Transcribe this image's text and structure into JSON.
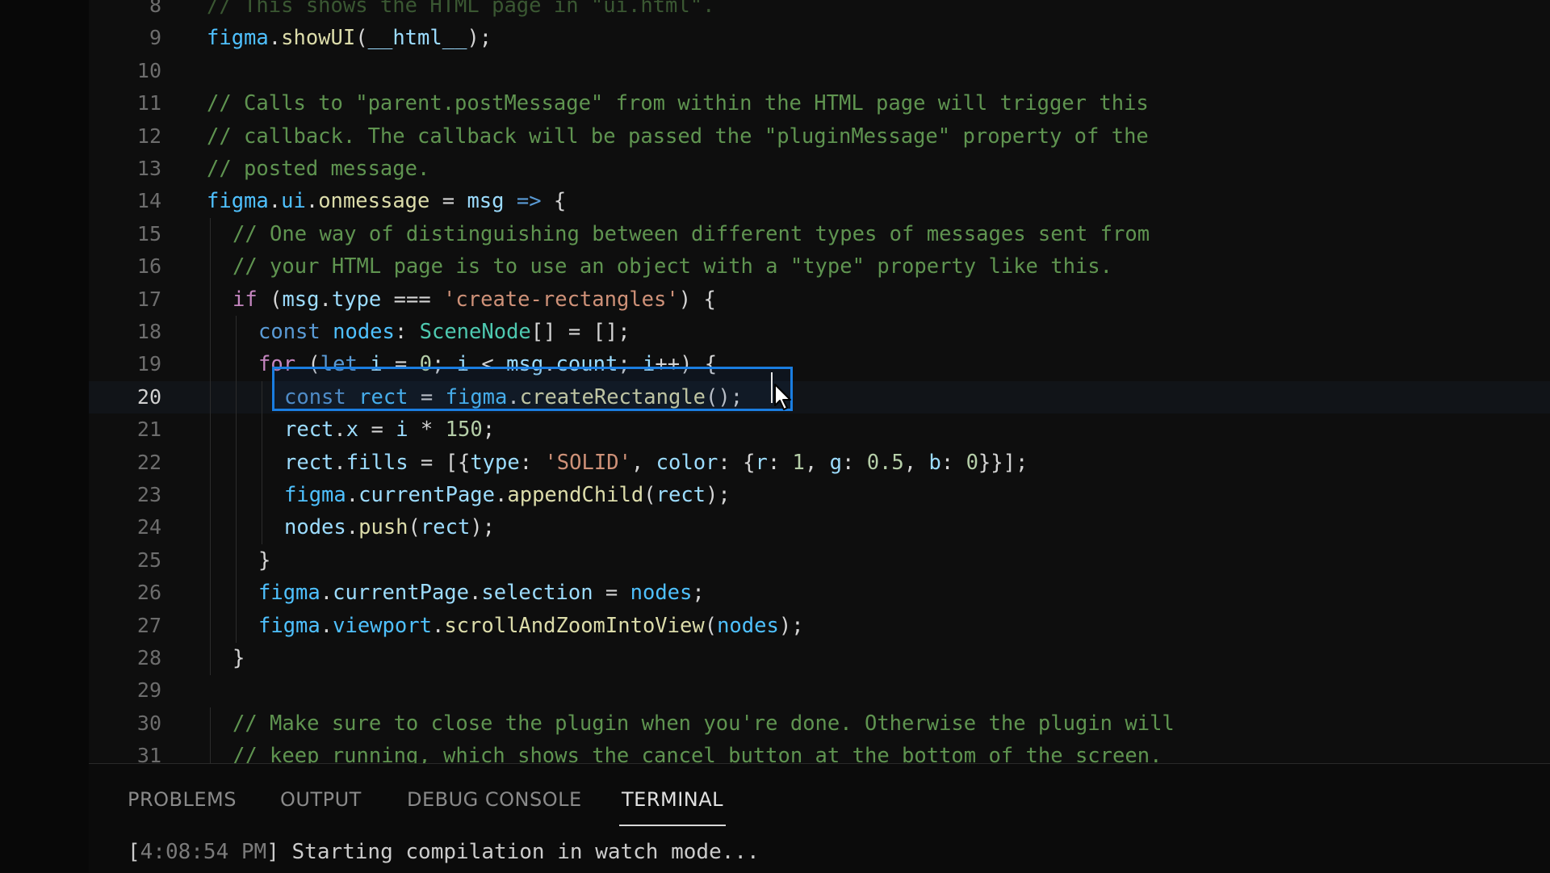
{
  "editor": {
    "lines": [
      {
        "n": "8",
        "indent": 0,
        "tokens": [
          [
            "cm",
            "// This shows the HTML page in \"ui.html\"."
          ]
        ]
      },
      {
        "n": "9",
        "indent": 0,
        "tokens": [
          [
            "obj",
            "figma"
          ],
          [
            "pun",
            "."
          ],
          [
            "fn",
            "showUI"
          ],
          [
            "pun",
            "("
          ],
          [
            "var",
            "__html__"
          ],
          [
            "pun",
            ");"
          ]
        ]
      },
      {
        "n": "10",
        "indent": 0,
        "tokens": []
      },
      {
        "n": "11",
        "indent": 0,
        "tokens": [
          [
            "cm",
            "// Calls to \"parent.postMessage\" from within the HTML page will trigger this"
          ]
        ]
      },
      {
        "n": "12",
        "indent": 0,
        "tokens": [
          [
            "cm",
            "// callback. The callback will be passed the \"pluginMessage\" property of the"
          ]
        ]
      },
      {
        "n": "13",
        "indent": 0,
        "tokens": [
          [
            "cm",
            "// posted message."
          ]
        ]
      },
      {
        "n": "14",
        "indent": 0,
        "tokens": [
          [
            "obj",
            "figma"
          ],
          [
            "pun",
            "."
          ],
          [
            "obj",
            "ui"
          ],
          [
            "pun",
            "."
          ],
          [
            "fn",
            "onmessage"
          ],
          [
            "pun",
            " = "
          ],
          [
            "var",
            "msg"
          ],
          [
            "pun",
            " "
          ],
          [
            "kw",
            "=>"
          ],
          [
            "pun",
            " {"
          ]
        ]
      },
      {
        "n": "15",
        "indent": 1,
        "tokens": [
          [
            "cm",
            "// One way of distinguishing between different types of messages sent from"
          ]
        ]
      },
      {
        "n": "16",
        "indent": 1,
        "tokens": [
          [
            "cm",
            "// your HTML page is to use an object with a \"type\" property like this."
          ]
        ]
      },
      {
        "n": "17",
        "indent": 1,
        "tokens": [
          [
            "ctl",
            "if"
          ],
          [
            "pun",
            " ("
          ],
          [
            "var",
            "msg"
          ],
          [
            "pun",
            "."
          ],
          [
            "var",
            "type"
          ],
          [
            "pun",
            " === "
          ],
          [
            "str",
            "'create-rectangles'"
          ],
          [
            "pun",
            ") {"
          ]
        ]
      },
      {
        "n": "18",
        "indent": 2,
        "tokens": [
          [
            "kw",
            "const"
          ],
          [
            "pun",
            " "
          ],
          [
            "obj",
            "nodes"
          ],
          [
            "pun",
            ": "
          ],
          [
            "ty",
            "SceneNode"
          ],
          [
            "pun",
            "[] = [];"
          ]
        ]
      },
      {
        "n": "19",
        "indent": 2,
        "tokens": [
          [
            "ctl",
            "for"
          ],
          [
            "pun",
            " ("
          ],
          [
            "kw",
            "let"
          ],
          [
            "pun",
            " "
          ],
          [
            "var",
            "i"
          ],
          [
            "pun",
            " = "
          ],
          [
            "num",
            "0"
          ],
          [
            "pun",
            "; "
          ],
          [
            "var",
            "i"
          ],
          [
            "pun",
            " < "
          ],
          [
            "var",
            "msg"
          ],
          [
            "pun",
            "."
          ],
          [
            "var",
            "count"
          ],
          [
            "pun",
            "; "
          ],
          [
            "var",
            "i"
          ],
          [
            "pun",
            "++) {"
          ]
        ]
      },
      {
        "n": "20",
        "indent": 3,
        "current": true,
        "tokens": [
          [
            "kw",
            "const"
          ],
          [
            "pun",
            " "
          ],
          [
            "obj",
            "rect"
          ],
          [
            "pun",
            " = "
          ],
          [
            "obj",
            "figma"
          ],
          [
            "pun",
            "."
          ],
          [
            "fn",
            "createRectangle"
          ],
          [
            "pun",
            "();"
          ]
        ]
      },
      {
        "n": "21",
        "indent": 3,
        "tokens": [
          [
            "var",
            "rect"
          ],
          [
            "pun",
            "."
          ],
          [
            "var",
            "x"
          ],
          [
            "pun",
            " = "
          ],
          [
            "var",
            "i"
          ],
          [
            "pun",
            " * "
          ],
          [
            "num",
            "150"
          ],
          [
            "pun",
            ";"
          ]
        ]
      },
      {
        "n": "22",
        "indent": 3,
        "tokens": [
          [
            "var",
            "rect"
          ],
          [
            "pun",
            "."
          ],
          [
            "var",
            "fills"
          ],
          [
            "pun",
            " = [{"
          ],
          [
            "var",
            "type"
          ],
          [
            "pun",
            ": "
          ],
          [
            "str",
            "'SOLID'"
          ],
          [
            "pun",
            ", "
          ],
          [
            "var",
            "color"
          ],
          [
            "pun",
            ": {"
          ],
          [
            "var",
            "r"
          ],
          [
            "pun",
            ": "
          ],
          [
            "num",
            "1"
          ],
          [
            "pun",
            ", "
          ],
          [
            "var",
            "g"
          ],
          [
            "pun",
            ": "
          ],
          [
            "num",
            "0.5"
          ],
          [
            "pun",
            ", "
          ],
          [
            "var",
            "b"
          ],
          [
            "pun",
            ": "
          ],
          [
            "num",
            "0"
          ],
          [
            "pun",
            "}}];"
          ]
        ]
      },
      {
        "n": "23",
        "indent": 3,
        "tokens": [
          [
            "obj",
            "figma"
          ],
          [
            "pun",
            "."
          ],
          [
            "var",
            "currentPage"
          ],
          [
            "pun",
            "."
          ],
          [
            "fn",
            "appendChild"
          ],
          [
            "pun",
            "("
          ],
          [
            "var",
            "rect"
          ],
          [
            "pun",
            ");"
          ]
        ]
      },
      {
        "n": "24",
        "indent": 3,
        "tokens": [
          [
            "var",
            "nodes"
          ],
          [
            "pun",
            "."
          ],
          [
            "fn",
            "push"
          ],
          [
            "pun",
            "("
          ],
          [
            "var",
            "rect"
          ],
          [
            "pun",
            ");"
          ]
        ]
      },
      {
        "n": "25",
        "indent": 2,
        "tokens": [
          [
            "pun",
            "}"
          ]
        ]
      },
      {
        "n": "26",
        "indent": 2,
        "tokens": [
          [
            "obj",
            "figma"
          ],
          [
            "pun",
            "."
          ],
          [
            "var",
            "currentPage"
          ],
          [
            "pun",
            "."
          ],
          [
            "var",
            "selection"
          ],
          [
            "pun",
            " = "
          ],
          [
            "obj",
            "nodes"
          ],
          [
            "pun",
            ";"
          ]
        ]
      },
      {
        "n": "27",
        "indent": 2,
        "tokens": [
          [
            "obj",
            "figma"
          ],
          [
            "pun",
            "."
          ],
          [
            "obj",
            "viewport"
          ],
          [
            "pun",
            "."
          ],
          [
            "fn",
            "scrollAndZoomIntoView"
          ],
          [
            "pun",
            "("
          ],
          [
            "obj",
            "nodes"
          ],
          [
            "pun",
            ");"
          ]
        ]
      },
      {
        "n": "28",
        "indent": 1,
        "tokens": [
          [
            "pun",
            "}"
          ]
        ]
      },
      {
        "n": "29",
        "indent": 0,
        "tokens": []
      },
      {
        "n": "30",
        "indent": 1,
        "tokens": [
          [
            "cm",
            "// Make sure to close the plugin when you're done. Otherwise the plugin will"
          ]
        ]
      },
      {
        "n": "31",
        "indent": 1,
        "tokens": [
          [
            "cm",
            "// keep running, which shows the cancel button at the bottom of the screen."
          ]
        ]
      }
    ]
  },
  "panel": {
    "tabs": [
      {
        "id": "problems",
        "label": "PROBLEMS",
        "active": false
      },
      {
        "id": "output",
        "label": "OUTPUT",
        "active": false
      },
      {
        "id": "debug-console",
        "label": "DEBUG CONSOLE",
        "active": false
      },
      {
        "id": "terminal",
        "label": "TERMINAL",
        "active": true
      }
    ],
    "terminal": {
      "timestamp": "4:08:54 PM",
      "message": "Starting compilation in watch mode..."
    }
  },
  "icons": {
    "cursor": "mouse-pointer-icon"
  }
}
